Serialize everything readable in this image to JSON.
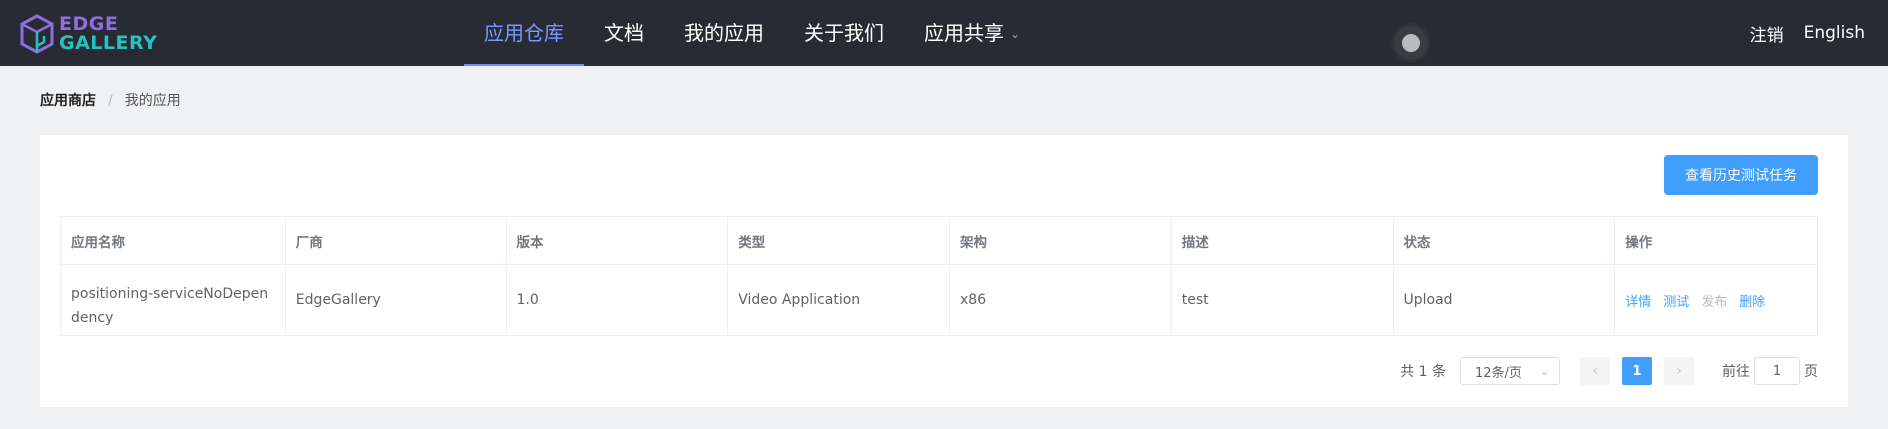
{
  "brand": {
    "line1": "EDGE",
    "line2": "GALLERY",
    "primary_color": "#8f6ee0",
    "secondary_color": "#25c2c2"
  },
  "nav": {
    "items": [
      {
        "label": "应用仓库",
        "active": true
      },
      {
        "label": "文档"
      },
      {
        "label": "我的应用"
      },
      {
        "label": "关于我们"
      },
      {
        "label": "应用共享",
        "has_dropdown": true
      }
    ]
  },
  "header_right": {
    "logout": "注销",
    "language": "English"
  },
  "breadcrumb": {
    "home": "应用商店",
    "separator": "/",
    "current": "我的应用"
  },
  "toolbar": {
    "history_button": "查看历史测试任务"
  },
  "table": {
    "columns": [
      "应用名称",
      "厂商",
      "版本",
      "类型",
      "架构",
      "描述",
      "状态",
      "操作"
    ],
    "rows": [
      {
        "name": "positioning-serviceNoDependency",
        "vendor": "EdgeGallery",
        "version": "1.0",
        "type": "Video Application",
        "arch": "x86",
        "desc": "test",
        "status": "Upload",
        "actions": [
          "详情",
          "测试",
          "发布",
          "删除"
        ]
      }
    ]
  },
  "pagination": {
    "total": "共 1 条",
    "page_size": "12条/页",
    "current_page": "1",
    "goto_prefix": "前往",
    "goto_value": "1",
    "goto_suffix": "页"
  },
  "colors": {
    "accent": "#409eff",
    "topbar": "#282b33",
    "nav_active": "#7a97ff"
  }
}
